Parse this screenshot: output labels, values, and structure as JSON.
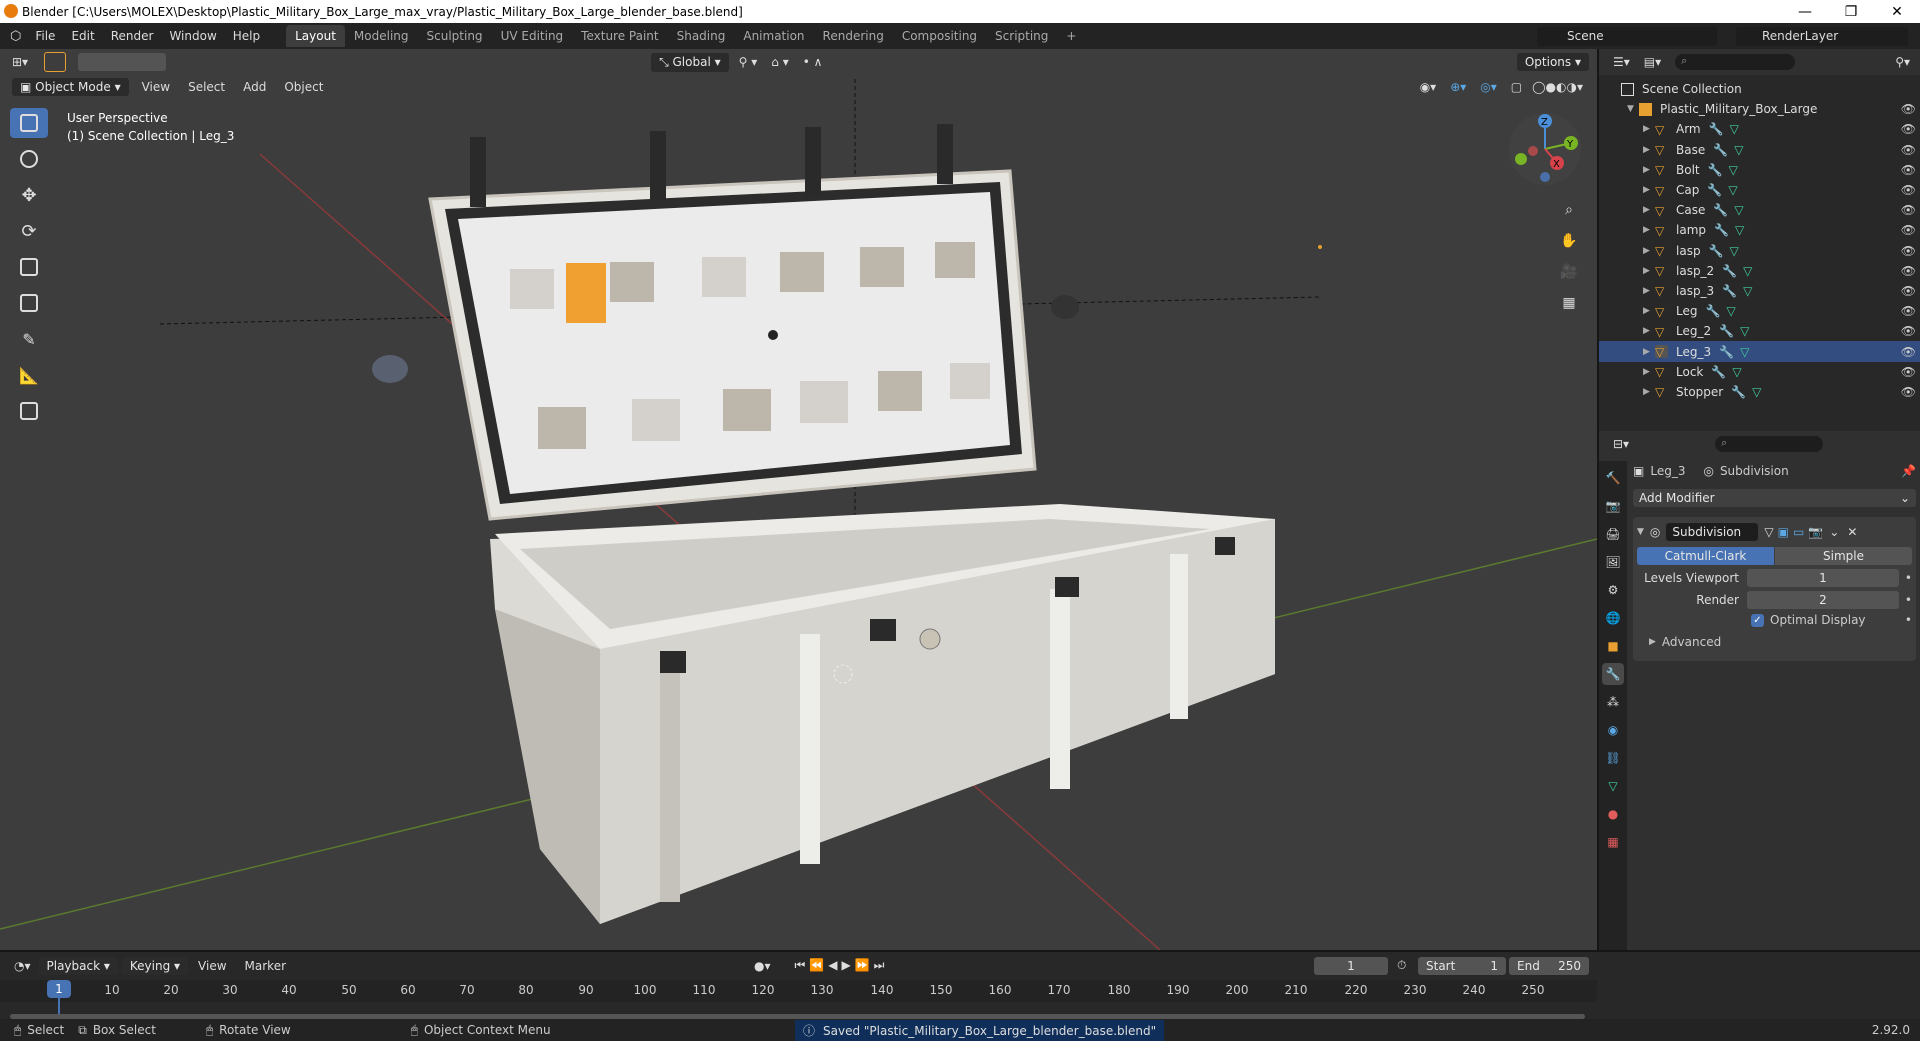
{
  "window": {
    "title": "Blender [C:\\Users\\MOLEX\\Desktop\\Plastic_Military_Box_Large_max_vray/Plastic_Military_Box_Large_blender_base.blend]",
    "controls": [
      "—",
      "❐",
      "✕"
    ]
  },
  "menu": [
    "File",
    "Edit",
    "Render",
    "Window",
    "Help"
  ],
  "workspaces": [
    "Layout",
    "Modeling",
    "Sculpting",
    "UV Editing",
    "Texture Paint",
    "Shading",
    "Animation",
    "Rendering",
    "Compositing",
    "Scripting",
    "+"
  ],
  "scene": "Scene",
  "render_layer": "RenderLayer",
  "viewport": {
    "mode": "Object Mode",
    "menus": [
      "View",
      "Select",
      "Add",
      "Object"
    ],
    "orientation": "Global",
    "options_label": "Options",
    "overlay_line1": "User Perspective",
    "overlay_line2": "(1) Scene Collection | Leg_3",
    "gizmo_axes": [
      "X",
      "Y",
      "Z"
    ]
  },
  "outliner": {
    "root": "Scene Collection",
    "collection": "Plastic_Military_Box_Large",
    "items": [
      "Arm",
      "Base",
      "Bolt",
      "Cap",
      "Case",
      "lamp",
      "lasp",
      "lasp_2",
      "lasp_3",
      "Leg",
      "Leg_2",
      "Leg_3",
      "Lock",
      "Stopper"
    ],
    "selected": "Leg_3"
  },
  "properties": {
    "object": "Leg_3",
    "modifier_crumb": "Subdivision",
    "add_modifier": "Add Modifier",
    "modifier_name": "Subdivision",
    "method_a": "Catmull-Clark",
    "method_b": "Simple",
    "levels_viewport_label": "Levels Viewport",
    "levels_viewport": "1",
    "render_label": "Render",
    "render": "2",
    "optimal_display": "Optimal Display",
    "advanced": "Advanced"
  },
  "timeline": {
    "menus": [
      "Playback",
      "Keying",
      "View",
      "Marker"
    ],
    "current_frame": "1",
    "start_label": "Start",
    "start": "1",
    "end_label": "End",
    "end": "250",
    "ticks": [
      "10",
      "20",
      "30",
      "40",
      "50",
      "60",
      "70",
      "80",
      "90",
      "100",
      "110",
      "120",
      "130",
      "140",
      "150",
      "160",
      "170",
      "180",
      "190",
      "200",
      "210",
      "220",
      "230",
      "240",
      "250"
    ]
  },
  "status": {
    "select": "Select",
    "box_select": "Box Select",
    "rotate_view": "Rotate View",
    "context_menu": "Object Context Menu",
    "message": "Saved \"Plastic_Military_Box_Large_blender_base.blend\"",
    "version": "2.92.0"
  }
}
